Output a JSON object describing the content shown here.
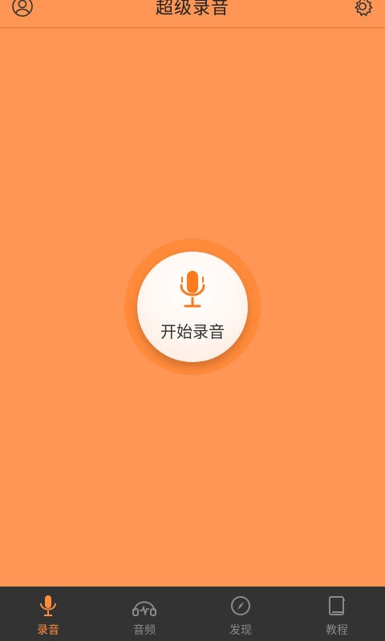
{
  "header": {
    "title": "超级录音",
    "left_icon": "profile-icon",
    "right_icon": "settings-icon"
  },
  "record": {
    "label": "开始录音",
    "icon": "microphone-icon"
  },
  "tabs": [
    {
      "label": "录音",
      "icon": "microphone-icon",
      "active": true
    },
    {
      "label": "音频",
      "icon": "headphones-icon",
      "active": false
    },
    {
      "label": "发现",
      "icon": "compass-icon",
      "active": false
    },
    {
      "label": "教程",
      "icon": "book-icon",
      "active": false
    }
  ],
  "colors": {
    "background": "#ff9655",
    "accent": "#ff8c3b",
    "tabbar": "#333333"
  }
}
